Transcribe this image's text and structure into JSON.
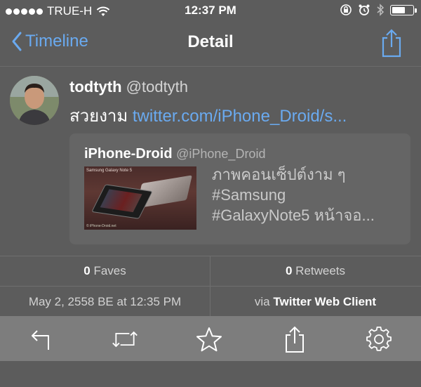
{
  "status_bar": {
    "carrier": "TRUE-H",
    "time": "12:37 PM",
    "battery_level": 0.65
  },
  "nav": {
    "back_label": "Timeline",
    "title": "Detail",
    "accent_color": "#6aaaf0"
  },
  "tweet": {
    "user_name": "todtyth",
    "user_handle": "@todtyth",
    "text_prefix": "สวยงาม ",
    "link": "twitter.com/iPhone_Droid/s..."
  },
  "quote": {
    "user_name": "iPhone-Droid",
    "user_handle": "@iPhone_Droid",
    "image_caption": "Samsung Galaxy Note 5",
    "image_footer": "© iPhone-Droid.net",
    "lines": [
      "ภาพคอนเซ็ปต์งาม ๆ",
      "#Samsung",
      "#GalaxyNote5 หน้าจอ..."
    ]
  },
  "stats": {
    "faves_count": "0",
    "faves_label": " Faves",
    "retweets_count": "0",
    "retweets_label": " Retweets",
    "date": "May 2, 2558 BE at 12:35 PM",
    "via_prefix": "via ",
    "client": "Twitter Web Client"
  },
  "toolbar": {
    "icons": [
      "reply-icon",
      "retweet-icon",
      "star-icon",
      "share-icon",
      "gear-icon"
    ]
  }
}
